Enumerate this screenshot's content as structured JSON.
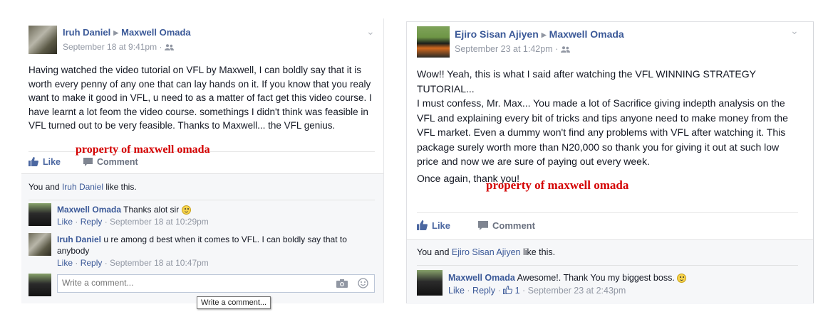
{
  "post1": {
    "author": "Iruh Daniel",
    "recipient": "Maxwell Omada",
    "timestamp": "September 18 at 9:41pm",
    "body": "Having watched the video tutorial on VFL by Maxwell, I can boldly say that it is worth every penny of any one that can lay hands on it. If you know that you realy want to make it good in VFL, u need to as a matter of fact get this video course. I have learnt a lot feom the video course. somethings I didn't think was feasible in VFL turned out to be very feasible. Thanks to Maxwell... the VFL genius.",
    "watermark": "property of maxwell omada",
    "like_label": "Like",
    "comment_label": "Comment",
    "likes": {
      "prefix": "You and ",
      "name": "Iruh Daniel",
      "suffix": " like this."
    },
    "comments": [
      {
        "author": "Maxwell Omada",
        "text": "Thanks alot sir",
        "like": "Like",
        "reply": "Reply",
        "time": "September 18 at 10:29pm"
      },
      {
        "author": "Iruh Daniel",
        "text": "u re among d best when it comes to VFL. I can boldly say that to anybody",
        "like": "Like",
        "reply": "Reply",
        "time": "September 18 at 10:47pm"
      }
    ],
    "compose_placeholder": "Write a comment...",
    "tooltip": "Write a comment..."
  },
  "post2": {
    "author": "Ejiro Sisan Ajiyen",
    "recipient": "Maxwell Omada",
    "timestamp": "September 23 at 1:42pm",
    "body_lines": [
      "Wow!! Yeah, this is what I said after watching the VFL WINNING STRATEGY TUTORIAL...",
      "I must confess, Mr. Max... You made a lot of Sacrifice giving indepth analysis on the VFL and explaining every bit of tricks and tips anyone need to make money from the VFL market. Even a dummy won't find any problems with VFL after watching it. This package surely worth more than N20,000 so thank you for giving it out at such low price and now we are sure of paying out every week.",
      "Once again, thank you!"
    ],
    "watermark": "property of maxwell omada",
    "like_label": "Like",
    "comment_label": "Comment",
    "likes": {
      "prefix": "You and ",
      "name": "Ejiro Sisan Ajiyen",
      "suffix": " like this."
    },
    "comments": [
      {
        "author": "Maxwell Omada",
        "text": "Awesome!. Thank You my biggest boss.",
        "like": "Like",
        "reply": "Reply",
        "like_count": "1",
        "time": "September 23 at 2:43pm"
      }
    ]
  },
  "colors": {
    "link": "#3b5998",
    "meta": "#9197a3",
    "watermark": "#d40000"
  }
}
